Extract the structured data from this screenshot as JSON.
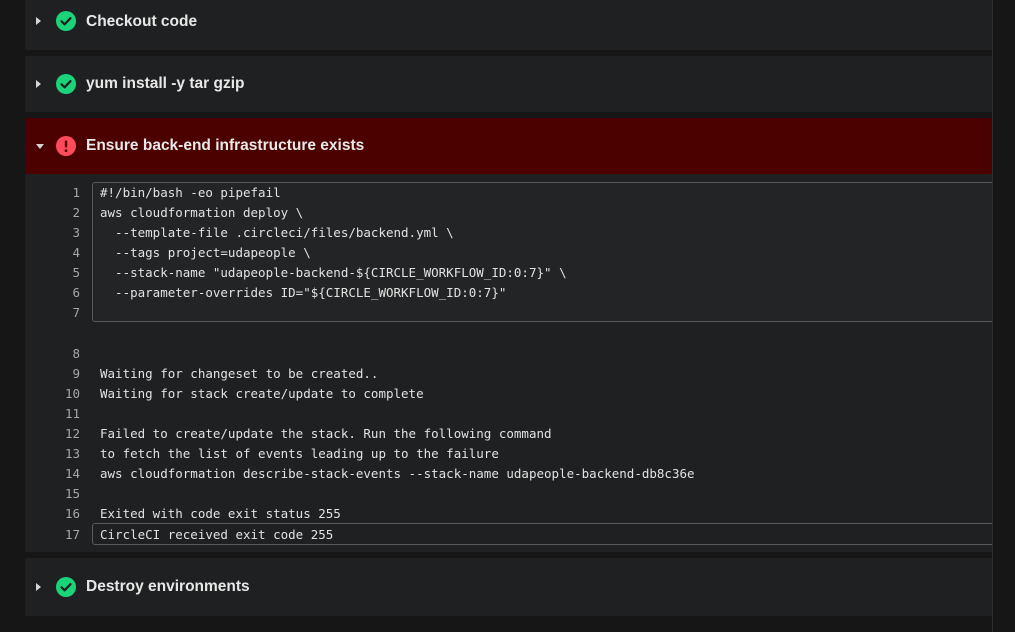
{
  "colors": {
    "success": "#1bd47a",
    "failure": "#ff4b5c",
    "failed_bg": "#4c0101"
  },
  "steps": [
    {
      "title": "Checkout code",
      "status": "success",
      "icon": "check-circle-icon",
      "expanded": false
    },
    {
      "title": "yum install -y tar gzip",
      "status": "success",
      "icon": "check-circle-icon",
      "expanded": false
    },
    {
      "title": "Ensure back-end infrastructure exists",
      "status": "failed",
      "icon": "exclamation-circle-icon",
      "expanded": true
    },
    {
      "title": "Destroy environments",
      "status": "success",
      "icon": "check-circle-icon",
      "expanded": false
    }
  ],
  "log": {
    "lines": [
      {
        "n": "1",
        "text": "#!/bin/bash -eo pipefail"
      },
      {
        "n": "2",
        "text": "aws cloudformation deploy \\"
      },
      {
        "n": "3",
        "text": "  --template-file .circleci/files/backend.yml \\"
      },
      {
        "n": "4",
        "text": "  --tags project=udapeople \\"
      },
      {
        "n": "5",
        "text": "  --stack-name \"udapeople-backend-${CIRCLE_WORKFLOW_ID:0:7}\" \\"
      },
      {
        "n": "6",
        "text": "  --parameter-overrides ID=\"${CIRCLE_WORKFLOW_ID:0:7}\""
      },
      {
        "n": "7",
        "text": ""
      },
      {
        "n": "8",
        "text": ""
      },
      {
        "n": "9",
        "text": "Waiting for changeset to be created.."
      },
      {
        "n": "10",
        "text": "Waiting for stack create/update to complete"
      },
      {
        "n": "11",
        "text": ""
      },
      {
        "n": "12",
        "text": "Failed to create/update the stack. Run the following command"
      },
      {
        "n": "13",
        "text": "to fetch the list of events leading up to the failure"
      },
      {
        "n": "14",
        "text": "aws cloudformation describe-stack-events --stack-name udapeople-backend-db8c36e"
      },
      {
        "n": "15",
        "text": ""
      },
      {
        "n": "16",
        "text": "Exited with code exit status 255"
      },
      {
        "n": "17",
        "text": "CircleCI received exit code 255"
      }
    ]
  }
}
